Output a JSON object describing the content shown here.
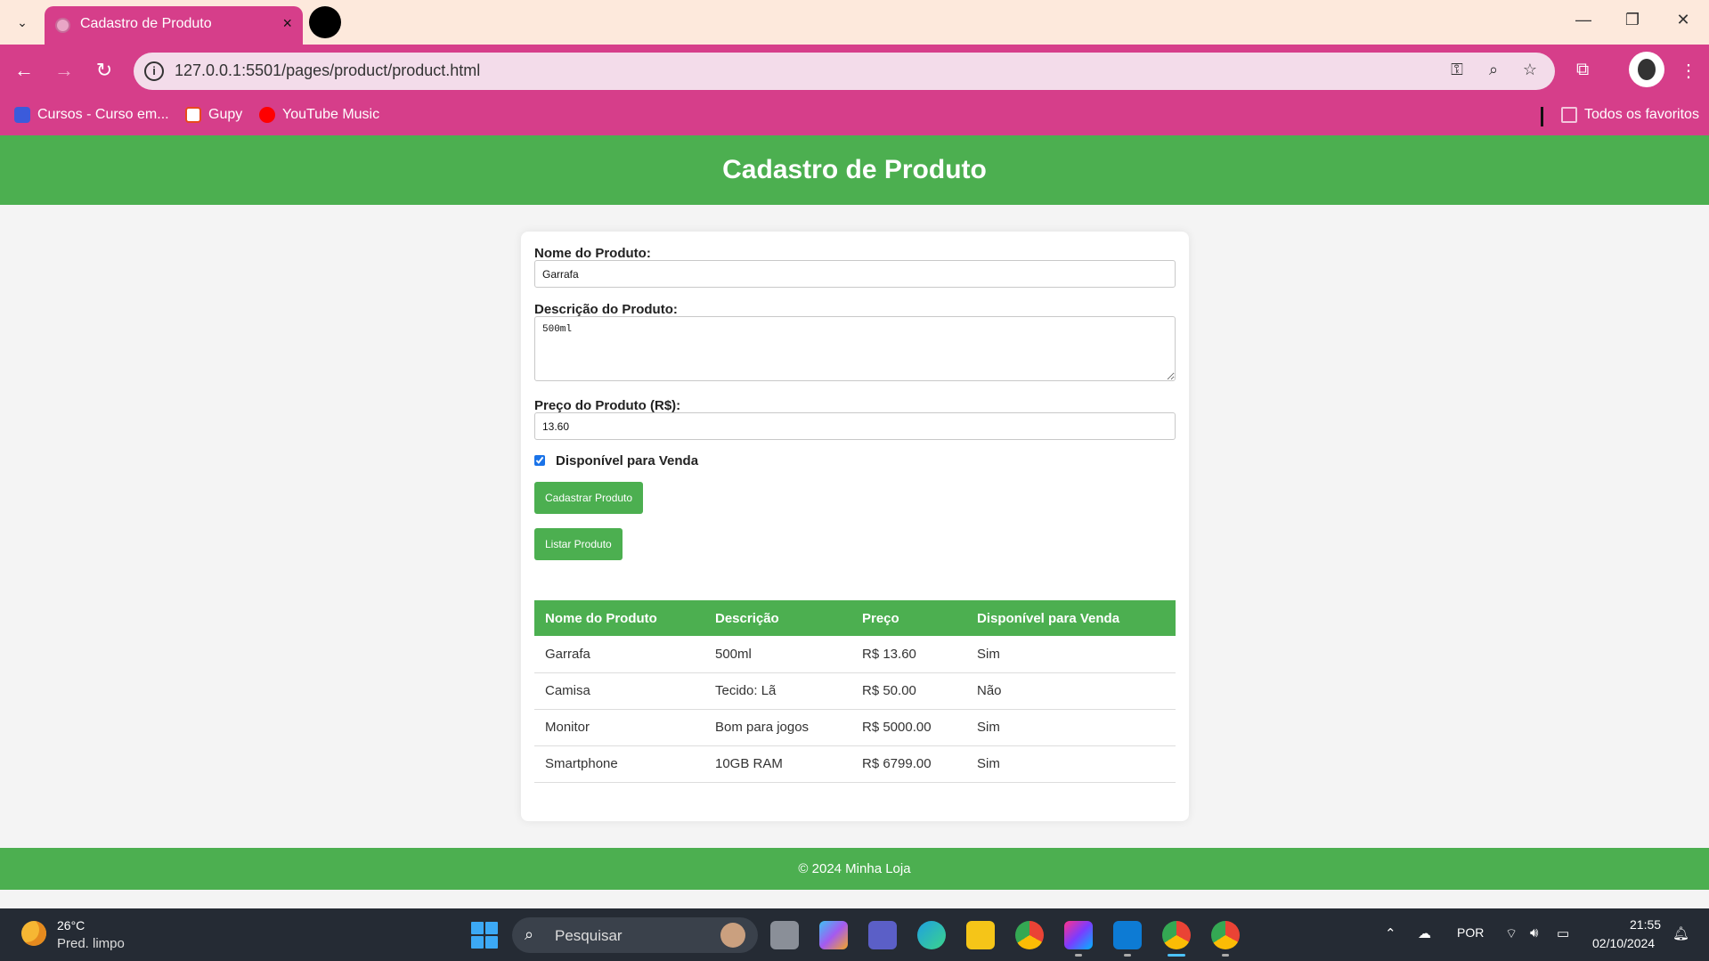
{
  "browser": {
    "tab_title": "Cadastro de Produto",
    "tab_close": "×",
    "url": "127.0.0.1:5501/pages/product/product.html",
    "bookmarks": [
      {
        "label": "Cursos - Curso em...",
        "color": "#3b5bdb"
      },
      {
        "label": "Gupy",
        "color": "#e8491d"
      },
      {
        "label": "YouTube Music",
        "color": "#ff0000"
      }
    ],
    "all_bookmarks_label": "Todos os favoritos",
    "accent_color": "#d63e8a"
  },
  "page": {
    "title": "Cadastro de Produto",
    "form": {
      "name_label": "Nome do Produto:",
      "name_value": "Garrafa",
      "description_label": "Descrição do Produto:",
      "description_value": "500ml",
      "price_label": "Preço do Produto (R$):",
      "price_value": "13.60",
      "available_label": "Disponível para Venda",
      "available_checked": true,
      "submit_label": "Cadastrar Produto",
      "list_label": "Listar Produto"
    },
    "table": {
      "headers": [
        "Nome do Produto",
        "Descrição",
        "Preço",
        "Disponível para Venda"
      ],
      "rows": [
        [
          "Garrafa",
          "500ml",
          "R$ 13.60",
          "Sim"
        ],
        [
          "Camisa",
          "Tecido: Lã",
          "R$ 50.00",
          "Não"
        ],
        [
          "Monitor",
          "Bom para jogos",
          "R$ 5000.00",
          "Sim"
        ],
        [
          "Smartphone",
          "10GB RAM",
          "R$ 6799.00",
          "Sim"
        ]
      ]
    },
    "footer": "© 2024 Minha Loja",
    "brand_color": "#4caf50"
  },
  "taskbar": {
    "weather_temp": "26°C",
    "weather_desc": "Pred. limpo",
    "search_placeholder": "Pesquisar",
    "language": "POR",
    "time": "21:55",
    "date": "02/10/2024"
  }
}
